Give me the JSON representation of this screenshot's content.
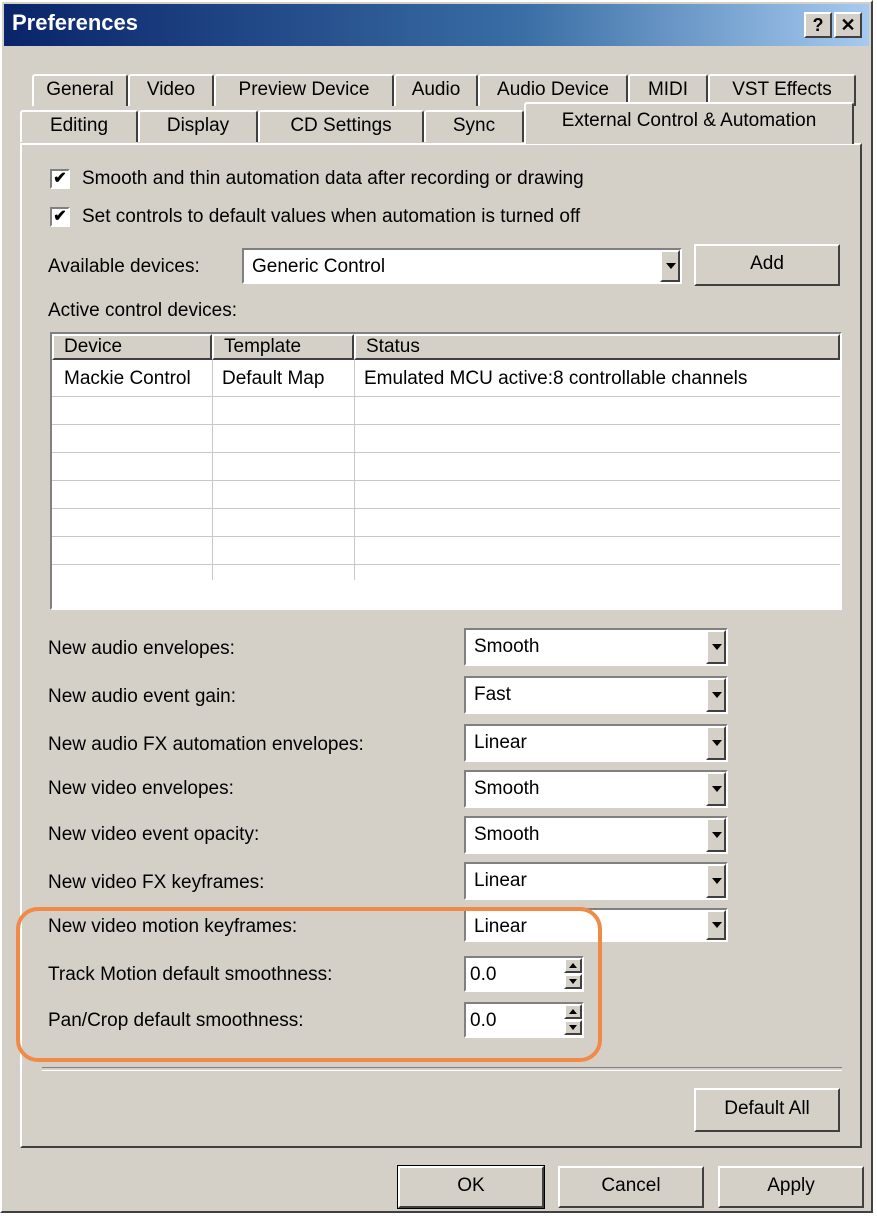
{
  "window": {
    "title": "Preferences",
    "help_glyph": "?",
    "close_glyph": "✕"
  },
  "tabs_row1": [
    "General",
    "Video",
    "Preview Device",
    "Audio",
    "Audio Device",
    "MIDI",
    "VST Effects"
  ],
  "tabs_row2": [
    "Editing",
    "Display",
    "CD Settings",
    "Sync",
    "External Control & Automation"
  ],
  "active_tab": "External Control & Automation",
  "checkboxes": [
    {
      "label": "Smooth and thin automation data after recording or drawing",
      "checked": true
    },
    {
      "label": "Set controls to default values when automation is turned off",
      "checked": true
    }
  ],
  "available_devices": {
    "label": "Available devices:",
    "value": "Generic Control",
    "add_button": "Add"
  },
  "active_devices": {
    "label": "Active control devices:",
    "columns": [
      "Device",
      "Template",
      "Status"
    ],
    "rows": [
      [
        "Mackie Control",
        "Default Map",
        "Emulated MCU active:8 controllable channels"
      ]
    ]
  },
  "envelope_settings": [
    {
      "label": "New audio envelopes:",
      "value": "Smooth"
    },
    {
      "label": "New audio event gain:",
      "value": "Fast"
    },
    {
      "label": "New audio FX automation envelopes:",
      "value": "Linear"
    },
    {
      "label": "New video envelopes:",
      "value": "Smooth"
    },
    {
      "label": "New video event opacity:",
      "value": "Smooth"
    },
    {
      "label": "New video FX keyframes:",
      "value": "Linear"
    },
    {
      "label": "New video motion keyframes:",
      "value": "Linear"
    }
  ],
  "smoothness": [
    {
      "label": "Track Motion default smoothness:",
      "value": "0.0"
    },
    {
      "label": "Pan/Crop default smoothness:",
      "value": "0.0"
    }
  ],
  "buttons": {
    "default_all": "Default All",
    "ok": "OK",
    "cancel": "Cancel",
    "apply": "Apply"
  },
  "colors": {
    "title_bar": "#0a246a",
    "face": "#d4d0c8",
    "highlight_annotation": "#f08a46"
  }
}
